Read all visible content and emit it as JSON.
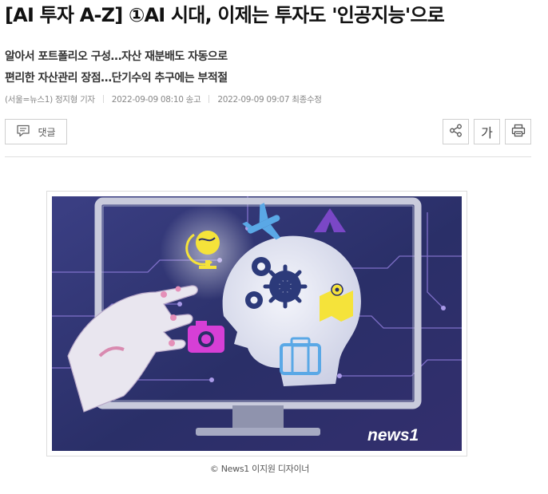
{
  "article": {
    "title": "[AI 투자 A-Z] ①AI 시대, 이제는 투자도 '인공지능'으로",
    "subtitle_lines": [
      "알아서 포트폴리오 구성…자산 재분배도 자동으로",
      "편리한 자산관리 장점…단기수익 추구에는 부적절"
    ],
    "byline": "(서울=뉴스1) 정지형 기자",
    "published": "2022-09-09 08:10 송고",
    "modified": "2022-09-09 09:07 최종수정"
  },
  "toolbar": {
    "comment_label": "댓글",
    "comment_icon": "speech-bubble-icon",
    "share_icon": "share-icon",
    "font_size_label": "가",
    "print_icon": "printer-icon"
  },
  "figure": {
    "watermark": "news1",
    "caption": "© News1 이지원 디자이너"
  },
  "colors": {
    "illustration_bg": "#2e3470",
    "circuit": "#8e7bd9",
    "magenta": "#d63fd6",
    "yellow": "#f5e33a",
    "sky": "#5aa8e6",
    "purple": "#7a47c6"
  }
}
